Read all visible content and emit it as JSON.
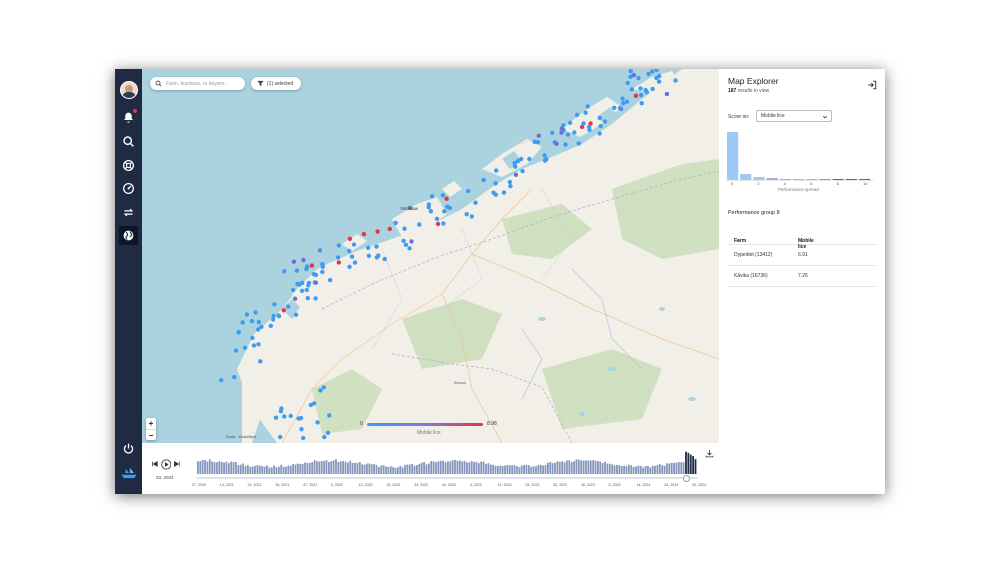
{
  "search": {
    "placeholder": "Farm, business, or keywor..."
  },
  "filter": {
    "label": "(1) selected"
  },
  "map": {
    "zoom_in": "+",
    "zoom_out": "−",
    "places": [
      "TROMSØ",
      "Bodø",
      "Kiruna",
      "Bodø · Bodøflyet"
    ],
    "legend": {
      "min": "0",
      "max": "8.98",
      "title": "Mobile lice"
    },
    "colors": {
      "low": "#3d9cf0",
      "mid": "#6d6fd2",
      "high": "#e8334b"
    }
  },
  "timeline": {
    "week": "33, 2024",
    "ticks": [
      "37, 2020",
      "14, 2021",
      "24, 2021",
      "36, 2021",
      "47, 2021",
      "3, 2022",
      "13, 2022",
      "23, 2022",
      "34, 2022",
      "44, 2022",
      "4, 2023",
      "14, 2023",
      "25, 2023",
      "35, 2023",
      "45, 2023",
      "5, 2024",
      "14, 2024",
      "24, 2024",
      "33, 2024"
    ],
    "bar_color": "#8596bd",
    "recent_color": "#1e2b42"
  },
  "panel": {
    "title": "Map Explorer",
    "results_count": "187",
    "results_suffix": " results in view",
    "score_label": "Score on:",
    "score_value": "Mobile lice",
    "hist_values": [
      48,
      6,
      3,
      2,
      1,
      1,
      1,
      1,
      1,
      1,
      1
    ],
    "hist_colors": [
      "#9ccaf5",
      "#9ccaf5",
      "#9ccaf5",
      "#a0b3cf",
      "#a0b3cf",
      "#c7a9b8",
      "#c7a9b8",
      "#d97b8a",
      "#e2334b",
      "#e2334b",
      "#e2334b"
    ],
    "hist_xticks": [
      "0",
      "2",
      "4",
      "6",
      "8",
      "10"
    ],
    "hist_axis": "Performance spread",
    "group_title": "Performance group 8",
    "table": {
      "headers": [
        "Farm",
        "Mobile lice"
      ],
      "rows": [
        [
          "Dypeidet (13412)",
          "6.91"
        ],
        [
          "Kåvika (16736)",
          "7.26"
        ]
      ]
    }
  }
}
